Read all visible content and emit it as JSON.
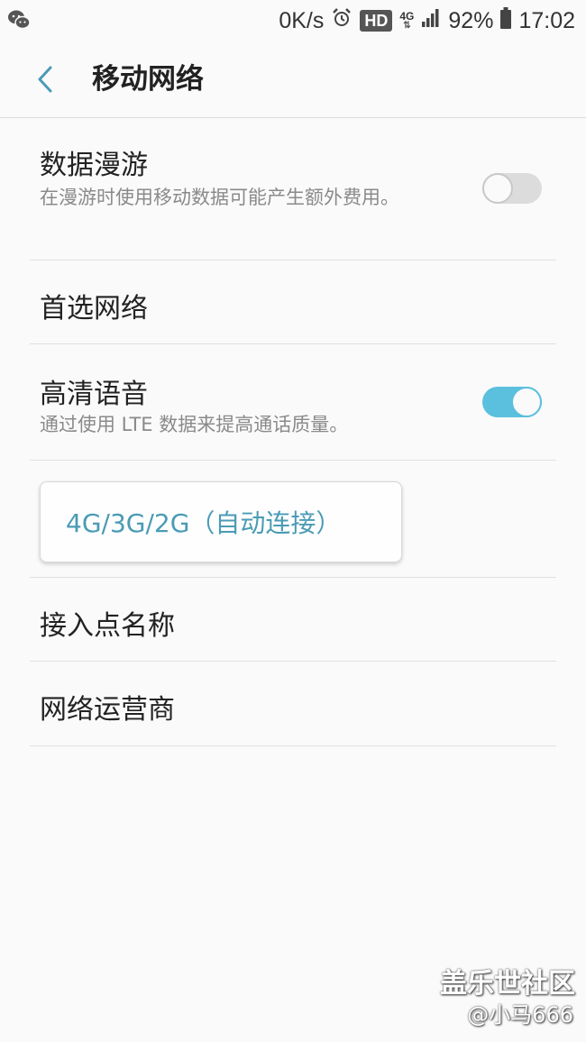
{
  "status_bar": {
    "net_speed": "0K/s",
    "hd": "HD",
    "network_type": "4G",
    "battery": "92%",
    "time": "17:02",
    "icons": [
      "wechat-icon",
      "alarm-icon",
      "signal-icon",
      "battery-icon"
    ]
  },
  "header": {
    "title": "移动网络",
    "back_icon": "chevron-left-icon",
    "accent_color": "#4a9bb5"
  },
  "settings": {
    "data_roaming": {
      "title": "数据漫游",
      "subtitle": "在漫游时使用移动数据可能产生额外费用。",
      "enabled": false
    },
    "preferred_network": {
      "title": "首选网络"
    },
    "hd_voice": {
      "title": "高清语音",
      "subtitle": "通过使用 LTE 数据来提高通话质量。",
      "enabled": true,
      "toggle_color": "#5bc0de"
    },
    "network_mode_dropdown": {
      "selected": "4G/3G/2G（自动连接）"
    },
    "apn": {
      "title": "接入点名称"
    },
    "network_operators": {
      "title": "网络运营商"
    }
  },
  "watermark": {
    "site": "盖乐世社区",
    "user": "@小马666"
  }
}
